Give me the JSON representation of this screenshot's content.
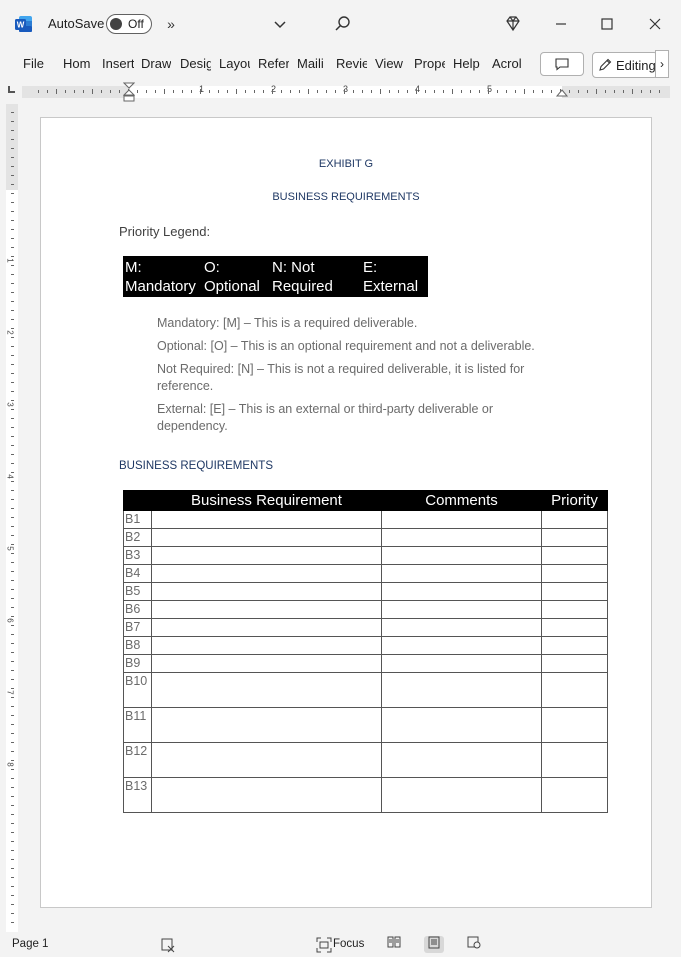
{
  "titlebar": {
    "app_icon": "word-logo-icon",
    "autosave_label": "AutoSave",
    "autosave_state": "Off",
    "overflow_icon": "chevron-double-right-icon",
    "dropdown_icon": "chevron-down-icon",
    "search_icon": "search-icon",
    "premium_icon": "diamond-icon",
    "minimize_icon": "minimize-icon",
    "maximize_icon": "maximize-icon",
    "close_icon": "close-icon"
  },
  "ribbon": {
    "tabs": [
      "File",
      "Home",
      "Insert",
      "Draw",
      "Design",
      "Layout",
      "References",
      "Mailings",
      "Review",
      "View",
      "Properties",
      "Help",
      "Acrobat"
    ],
    "tabs_visible": [
      "File",
      "Hom",
      "Insert",
      "Draw",
      "Desig",
      "Layou",
      "Refer",
      "Maili",
      "Revie",
      "View",
      "Prope",
      "Help",
      "Acrol"
    ],
    "comment_icon": "comment-icon",
    "editing_label": "Editing",
    "editing_icon": "pencil-icon",
    "more_icon": "chevron-right-icon"
  },
  "ruler": {
    "h_numbers": [
      "1",
      "2",
      "3",
      "4",
      "5"
    ],
    "v_numbers": [
      "1",
      "2",
      "3",
      "4",
      "5",
      "6",
      "7",
      "8"
    ]
  },
  "document": {
    "exhibit": "EXHIBIT G",
    "subtitle": "BUSINESS REQUIREMENTS",
    "legend_title": "Priority Legend:",
    "legend": [
      {
        "line1": "M:",
        "line2": "Mandatory"
      },
      {
        "line1": "O:",
        "line2": "Optional"
      },
      {
        "line1": "N: Not",
        "line2": "Required"
      },
      {
        "line1": "E:",
        "line2": "External"
      }
    ],
    "definitions": [
      "Mandatory: [M] – This is a required deliverable.",
      "Optional: [O] – This is an optional requirement and not a deliverable.",
      "Not Required: [N] – This is not a required deliverable, it is listed for reference.",
      "External: [E] – This is an external or third-party deliverable or dependency."
    ],
    "section_heading": "BUSINESS REQUIREMENTS",
    "table": {
      "headers": [
        "",
        "Business Requirement",
        "Comments",
        "Priority"
      ],
      "rows": [
        {
          "id": "B1",
          "requirement": "",
          "comments": "",
          "priority": ""
        },
        {
          "id": "B2",
          "requirement": "",
          "comments": "",
          "priority": ""
        },
        {
          "id": "B3",
          "requirement": "",
          "comments": "",
          "priority": ""
        },
        {
          "id": "B4",
          "requirement": "",
          "comments": "",
          "priority": ""
        },
        {
          "id": "B5",
          "requirement": "",
          "comments": "",
          "priority": ""
        },
        {
          "id": "B6",
          "requirement": "",
          "comments": "",
          "priority": ""
        },
        {
          "id": "B7",
          "requirement": "",
          "comments": "",
          "priority": ""
        },
        {
          "id": "B8",
          "requirement": "",
          "comments": "",
          "priority": ""
        },
        {
          "id": "B9",
          "requirement": "",
          "comments": "",
          "priority": ""
        },
        {
          "id": "B10",
          "requirement": "",
          "comments": "",
          "priority": ""
        },
        {
          "id": "B11",
          "requirement": "",
          "comments": "",
          "priority": ""
        },
        {
          "id": "B12",
          "requirement": "",
          "comments": "",
          "priority": ""
        },
        {
          "id": "B13",
          "requirement": "",
          "comments": "",
          "priority": ""
        }
      ]
    }
  },
  "statusbar": {
    "page": "Page 1",
    "proofing_icon": "proofing-icon",
    "focus_label": "Focus",
    "focus_icon": "focus-icon",
    "views": [
      "read-mode-icon",
      "print-layout-icon",
      "web-layout-icon"
    ],
    "active_view": "print-layout-icon"
  }
}
